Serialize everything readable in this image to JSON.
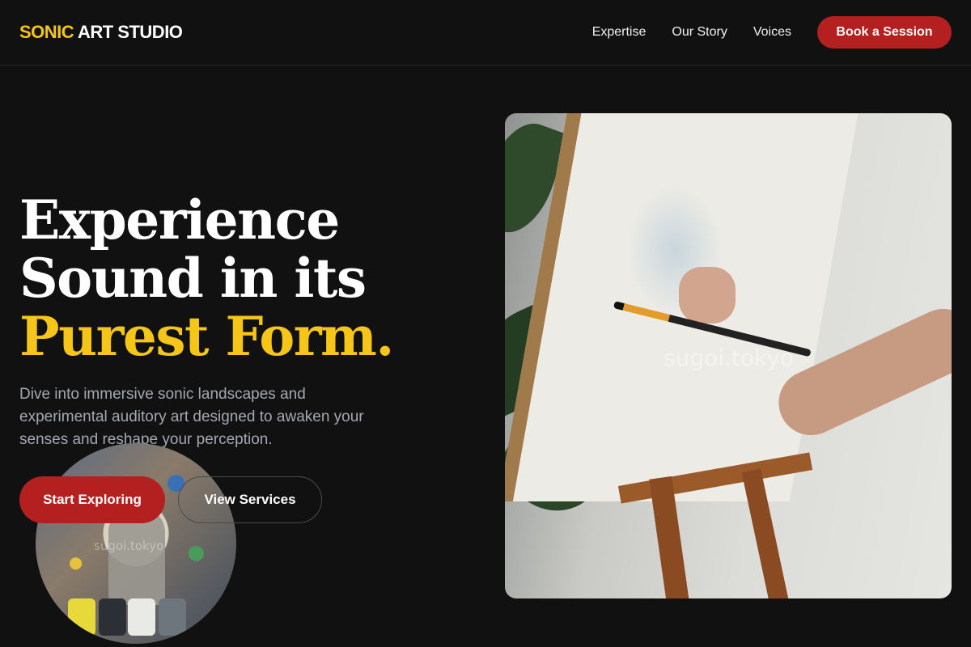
{
  "header": {
    "logo_accent": "SONIC",
    "logo_rest": " ART STUDIO",
    "nav": [
      "Expertise",
      "Our Story",
      "Voices"
    ],
    "cta_label": "Book a Session"
  },
  "hero": {
    "headline_line1": "Experience",
    "headline_line2": "Sound in its",
    "headline_line3": "Purest Form.",
    "subtext": "Dive into immersive sonic landscapes and experimental auditory art designed to awaken your senses and reshape your perception.",
    "primary_button": "Start Exploring",
    "secondary_button": "View Services"
  },
  "images": {
    "main_watermark": "sugoi.tokyo",
    "circle_watermark": "sugoi.tokyo"
  },
  "colors": {
    "background": "#111111",
    "accent_yellow": "#f5c518",
    "accent_red": "#b3201f",
    "subtext_gray": "#a3a8b0"
  }
}
